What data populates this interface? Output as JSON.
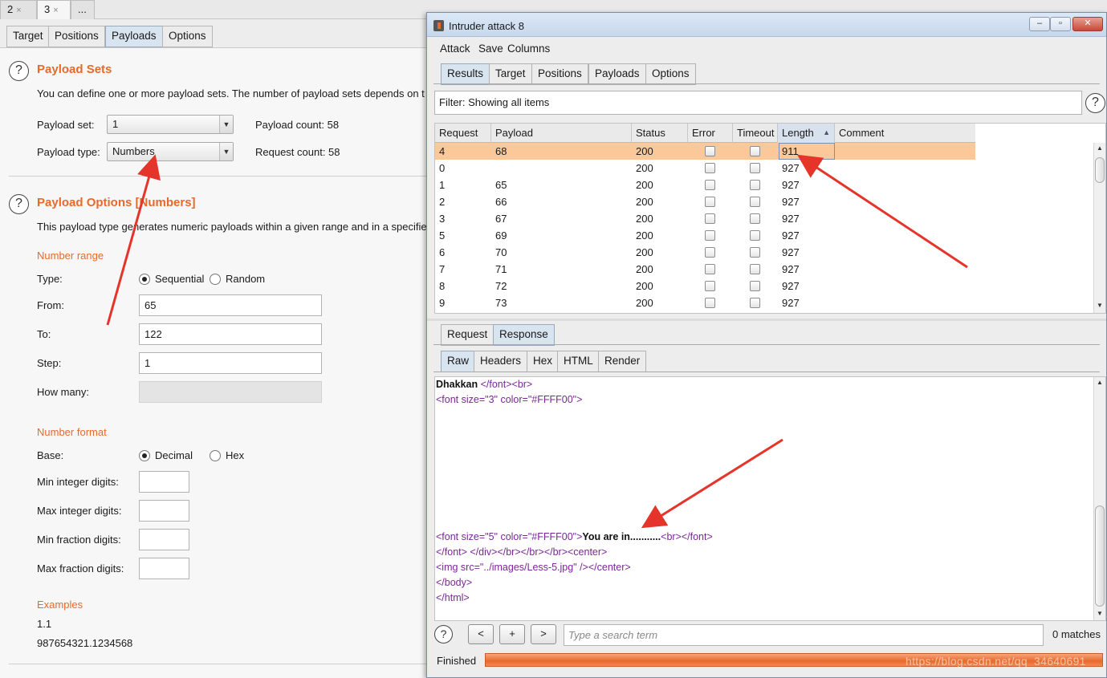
{
  "top_tabs": [
    {
      "label": "2",
      "close": "×"
    },
    {
      "label": "3",
      "close": "×"
    },
    {
      "label": "..."
    }
  ],
  "sub_tabs": [
    "Target",
    "Positions",
    "Payloads",
    "Options"
  ],
  "payload_sets": {
    "title": "Payload Sets",
    "description": "You can define one or more payload sets. The number of payload sets depends on t",
    "set_label": "Payload set:",
    "set_value": "1",
    "type_label": "Payload type:",
    "type_value": "Numbers",
    "payload_count": "Payload count:  58",
    "request_count": "Request count:  58"
  },
  "payload_options": {
    "title": "Payload Options [Numbers]",
    "description": "This payload type generates numeric payloads within a given range and in a specifie",
    "number_range": "Number range",
    "type_label": "Type:",
    "sequential": "Sequential",
    "random": "Random",
    "from_label": "From:",
    "from_value": "65",
    "to_label": "To:",
    "to_value": "122",
    "step_label": "Step:",
    "step_value": "1",
    "how_many_label": "How many:",
    "number_format": "Number format",
    "base_label": "Base:",
    "decimal": "Decimal",
    "hex": "Hex",
    "min_int": "Min integer digits:",
    "max_int": "Max integer digits:",
    "min_frac": "Min fraction digits:",
    "max_frac": "Max fraction digits:",
    "examples": "Examples",
    "example1": "1.1",
    "example2": "987654321.1234568"
  },
  "window": {
    "title": "Intruder attack 8",
    "buttons": [
      "–",
      "▫",
      "✕"
    ],
    "menu": [
      "Attack",
      "Save",
      "Columns"
    ],
    "tabs": [
      "Results",
      "Target",
      "Positions",
      "Payloads",
      "Options"
    ],
    "filter": "Filter: Showing all items",
    "help": "?"
  },
  "results": {
    "columns": [
      "Request",
      "Payload",
      "Status",
      "Error",
      "Timeout",
      "Length",
      "Comment"
    ],
    "sort_indicator": "▲",
    "rows": [
      {
        "request": "4",
        "payload": "68",
        "status": "200",
        "length": "911"
      },
      {
        "request": "0",
        "payload": "",
        "status": "200",
        "length": "927"
      },
      {
        "request": "1",
        "payload": "65",
        "status": "200",
        "length": "927"
      },
      {
        "request": "2",
        "payload": "66",
        "status": "200",
        "length": "927"
      },
      {
        "request": "3",
        "payload": "67",
        "status": "200",
        "length": "927"
      },
      {
        "request": "5",
        "payload": "69",
        "status": "200",
        "length": "927"
      },
      {
        "request": "6",
        "payload": "70",
        "status": "200",
        "length": "927"
      },
      {
        "request": "7",
        "payload": "71",
        "status": "200",
        "length": "927"
      },
      {
        "request": "8",
        "payload": "72",
        "status": "200",
        "length": "927"
      },
      {
        "request": "9",
        "payload": "73",
        "status": "200",
        "length": "927"
      }
    ]
  },
  "message_tabs": [
    "Request",
    "Response"
  ],
  "view_tabs": [
    "Raw",
    "Headers",
    "Hex",
    "HTML",
    "Render"
  ],
  "response_lines": {
    "l1_bold": "Dhakkan",
    "l1_tail": "</font><br>",
    "l2": "<font size=\"3\" color=\"#FFFF00\">",
    "l3_open": "<font size=\"5\" color=\"#FFFF00\">",
    "l3_bold": "You are in...........",
    "l3_tail": "<br></font>",
    "l4": "</font> </div></br></br></br><center>",
    "l5": "<img src=\"../images/Less-5.jpg\" /></center>",
    "l6": "</body>",
    "l7": "</html>"
  },
  "search": {
    "prev": "<",
    "add": "+",
    "next": ">",
    "placeholder": "Type a search term",
    "matches": "0 matches"
  },
  "status": {
    "label": "Finished",
    "progress": 1.0
  },
  "watermark": "https://blog.csdn.net/qq_34640691",
  "colors": {
    "accent": "#e8692a",
    "selected_row": "#fbc89a",
    "annotation_arrow": "#e5342a"
  }
}
